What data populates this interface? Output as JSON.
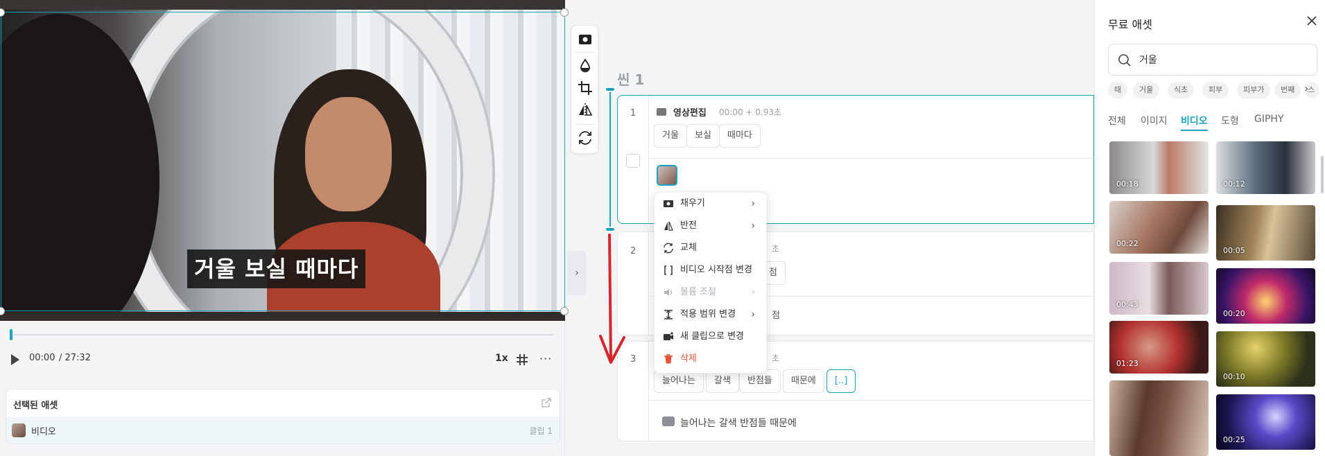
{
  "player": {
    "subtitle": "거울 보실 때마다",
    "current_time": "00:00",
    "total_time": "/ 27:32",
    "speed": "1x",
    "more": "···"
  },
  "selected_assets": {
    "title": "선택된 애셋",
    "item_name": "비디오",
    "item_clip": "클립 1"
  },
  "toolbar": {
    "icons": [
      "fill-icon",
      "color-drop-icon",
      "crop-icon",
      "flip-icon",
      "replace-icon"
    ]
  },
  "collapse_label": "›",
  "scene": {
    "title": "씬 1",
    "clips": [
      {
        "num": "1",
        "label": "영상편집",
        "time": "00:00 + 0.93초",
        "words": [
          "거울",
          "보실",
          "때마다"
        ]
      },
      {
        "num": "2",
        "time": "초",
        "word_partial": "점",
        "tail": "점"
      },
      {
        "num": "3",
        "time": "초",
        "words": [
          "늘어나는",
          "갈색",
          "반점들",
          "때문에",
          "[..]"
        ],
        "subtitle": "늘어나는 갈색 반점들 때문에"
      }
    ]
  },
  "context_menu": {
    "items": [
      {
        "label": "채우기",
        "icon": "fill-icon",
        "arrow": "›"
      },
      {
        "label": "반전",
        "icon": "flip-icon",
        "arrow": "›"
      },
      {
        "label": "교체",
        "icon": "replace-icon",
        "arrow": ""
      },
      {
        "label": "비디오 시작점 변경",
        "icon": "bracket-icon",
        "arrow": ""
      },
      {
        "label": "볼륨 조절",
        "icon": "volume-icon",
        "arrow": "›",
        "disabled": true
      },
      {
        "label": "적용 범위 변경",
        "icon": "range-icon",
        "arrow": "›"
      },
      {
        "label": "새 클립으로 변경",
        "icon": "new-clip-icon",
        "arrow": ""
      },
      {
        "label": "삭제",
        "icon": "trash-icon",
        "arrow": "",
        "danger": true
      }
    ]
  },
  "assets_panel": {
    "title": "무료 애셋",
    "search_value": "거울",
    "tags": [
      "때",
      "거울",
      "식초",
      "피부",
      "피부가",
      "번째",
      "스"
    ],
    "tabs": [
      "전체",
      "이미지",
      "비디오",
      "도형",
      "GIPHY"
    ],
    "active_tab": "비디오",
    "results": [
      {
        "duration": "00:18"
      },
      {
        "duration": "00:12"
      },
      {
        "duration": "00:22"
      },
      {
        "duration": "00:05"
      },
      {
        "duration": "00:43"
      },
      {
        "duration": "00:20"
      },
      {
        "duration": "01:23"
      },
      {
        "duration": "00:10"
      },
      {
        "duration": ""
      },
      {
        "duration": "00:25"
      }
    ]
  },
  "colors": {
    "accent": "#1aa2c0",
    "danger": "#e5533d",
    "arrow": "#d7262b"
  }
}
